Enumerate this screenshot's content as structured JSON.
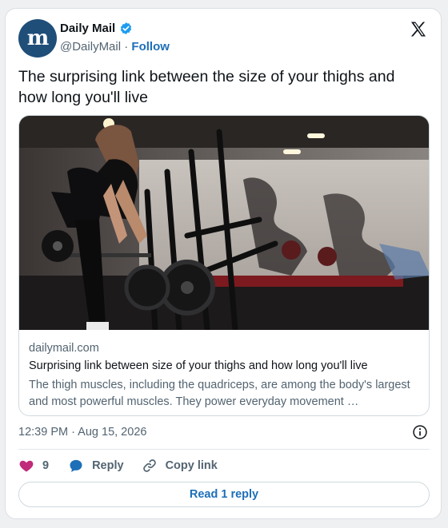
{
  "account": {
    "name": "Daily Mail",
    "handle": "@DailyMail",
    "separator": " · ",
    "follow_label": "Follow",
    "avatar_glyph": "m"
  },
  "tweet": {
    "text": "The surprising link between the size of your thighs and how long you'll live"
  },
  "link_card": {
    "domain": "dailymail.com",
    "headline": "Surprising link between size of your thighs and how long you'll live",
    "description": "The thigh muscles, including the quadriceps, are among the body's largest and most powerful muscles. They power everyday movement …",
    "image_alt": "Woman exercising with barbell weights in a gym"
  },
  "meta": {
    "time": "12:39 PM",
    "separator": " · ",
    "date": "Aug 15, 2026"
  },
  "actions": {
    "like_count": "9",
    "reply_label": "Reply",
    "copy_label": "Copy link"
  },
  "read_replies_label": "Read 1 reply",
  "colors": {
    "brand_blue": "#1d6fb8",
    "avatar_bg": "#1f4e79",
    "heart": "#c02b7a",
    "verified": "#1d9bf0"
  },
  "icons": [
    "verified-badge-icon",
    "x-logo-icon",
    "info-icon",
    "heart-icon",
    "reply-bubble-icon",
    "link-icon"
  ]
}
